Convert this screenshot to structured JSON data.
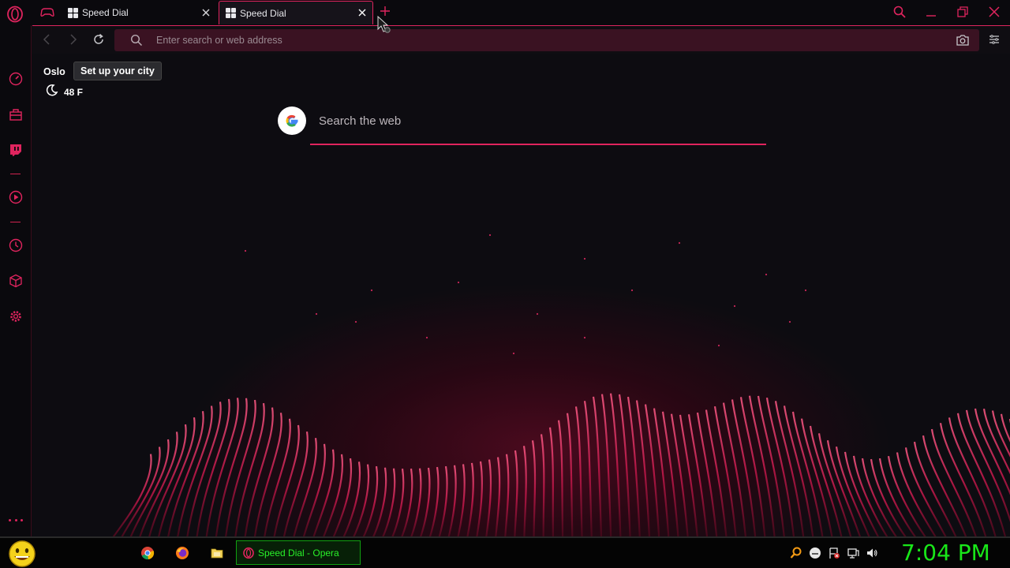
{
  "tabs": [
    {
      "label": "Speed Dial",
      "active": false
    },
    {
      "label": "Speed Dial",
      "active": true
    }
  ],
  "address_bar": {
    "placeholder": "Enter search or web address"
  },
  "weather": {
    "city": "Oslo",
    "tooltip": "Set up your city",
    "temperature": "48 F",
    "icon": "moon-icon"
  },
  "search": {
    "placeholder": "Search the web",
    "engine_icon": "google-icon"
  },
  "sidebar_icons": [
    "speed-dial-icon",
    "bag-icon",
    "twitch-icon",
    "player-icon",
    "history-icon",
    "cube-icon",
    "gear-icon",
    "more-icon"
  ],
  "taskbar": {
    "task_label": "Speed Dial - Opera",
    "clock": "7:04 PM",
    "icons": [
      "chrome-icon",
      "firefox-icon",
      "folder-icon"
    ]
  },
  "colors": {
    "accent": "#e0245e",
    "clock": "#19e619",
    "address_bg": "#3a1222"
  }
}
